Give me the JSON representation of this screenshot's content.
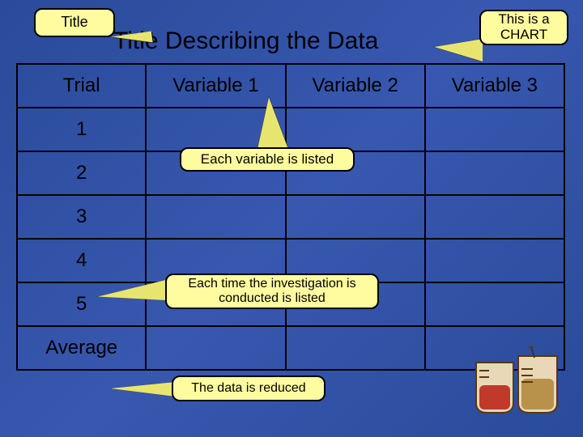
{
  "title": "Title Describing the Data",
  "callouts": {
    "title": "Title",
    "chart": "This is a CHART",
    "variable": "Each variable is listed",
    "trial": "Each time the investigation is conducted is listed",
    "average": "The data is reduced"
  },
  "table": {
    "headers": [
      "Trial",
      "Variable 1",
      "Variable 2",
      "Variable 3"
    ],
    "rows": [
      "1",
      "2",
      "3",
      "4",
      "5",
      "Average"
    ]
  },
  "chart_data": {
    "type": "table",
    "title": "Title Describing the Data",
    "columns": [
      "Trial",
      "Variable 1",
      "Variable 2",
      "Variable 3"
    ],
    "row_labels": [
      "1",
      "2",
      "3",
      "4",
      "5",
      "Average"
    ],
    "values": [
      [
        null,
        null,
        null
      ],
      [
        null,
        null,
        null
      ],
      [
        null,
        null,
        null
      ],
      [
        null,
        null,
        null
      ],
      [
        null,
        null,
        null
      ],
      [
        null,
        null,
        null
      ]
    ],
    "annotations": [
      "Title",
      "This is a CHART",
      "Each variable is listed",
      "Each time the investigation is conducted is listed",
      "The data is reduced"
    ]
  }
}
